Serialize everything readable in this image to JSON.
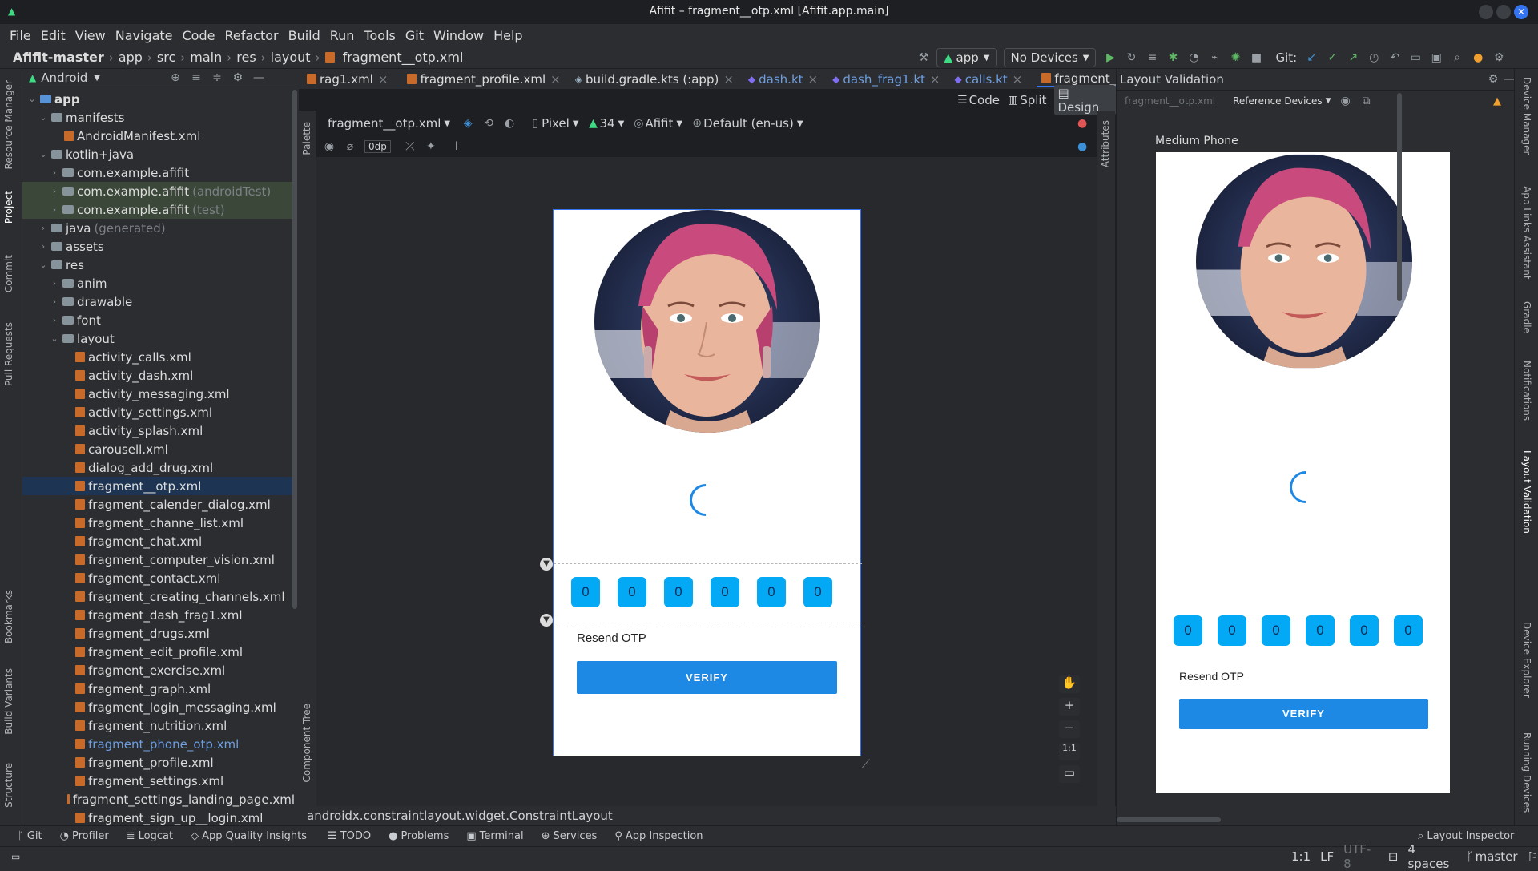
{
  "window": {
    "title": "Afifit – fragment__otp.xml [Afifit.app.main]"
  },
  "menu": [
    "File",
    "Edit",
    "View",
    "Navigate",
    "Code",
    "Refactor",
    "Build",
    "Run",
    "Tools",
    "Git",
    "Window",
    "Help"
  ],
  "breadcrumb": [
    "Afifit-master",
    "app",
    "src",
    "main",
    "res",
    "layout",
    "fragment__otp.xml"
  ],
  "toolbar": {
    "run_config": "app",
    "device": "No Devices",
    "git_label": "Git:"
  },
  "left_strip": [
    "Resource Manager",
    "Project",
    "Commit",
    "Pull Requests",
    "Bookmarks",
    "Build Variants",
    "Structure"
  ],
  "project": {
    "view_label": "Android",
    "tree": [
      {
        "label": "app",
        "depth": 0,
        "kind": "folder",
        "open": true,
        "bold": true
      },
      {
        "label": "manifests",
        "depth": 1,
        "kind": "folder",
        "open": true
      },
      {
        "label": "AndroidManifest.xml",
        "depth": 2,
        "kind": "xml"
      },
      {
        "label": "kotlin+java",
        "depth": 1,
        "kind": "folder",
        "open": true
      },
      {
        "label": "com.example.afifit",
        "depth": 2,
        "kind": "folder",
        "closed": true
      },
      {
        "label": "com.example.afifit",
        "suffix": "(androidTest)",
        "depth": 2,
        "kind": "folder",
        "closed": true,
        "hl": true
      },
      {
        "label": "com.example.afifit",
        "suffix": "(test)",
        "depth": 2,
        "kind": "folder",
        "closed": true,
        "hl": true
      },
      {
        "label": "java",
        "suffix": "(generated)",
        "depth": 1,
        "kind": "folder",
        "closed": true
      },
      {
        "label": "assets",
        "depth": 1,
        "kind": "folder",
        "closed": true
      },
      {
        "label": "res",
        "depth": 1,
        "kind": "folder",
        "open": true
      },
      {
        "label": "anim",
        "depth": 2,
        "kind": "folder",
        "closed": true
      },
      {
        "label": "drawable",
        "depth": 2,
        "kind": "folder",
        "closed": true
      },
      {
        "label": "font",
        "depth": 2,
        "kind": "folder",
        "closed": true
      },
      {
        "label": "layout",
        "depth": 2,
        "kind": "folder",
        "open": true
      },
      {
        "label": "activity_calls.xml",
        "depth": 3,
        "kind": "xml"
      },
      {
        "label": "activity_dash.xml",
        "depth": 3,
        "kind": "xml"
      },
      {
        "label": "activity_messaging.xml",
        "depth": 3,
        "kind": "xml"
      },
      {
        "label": "activity_settings.xml",
        "depth": 3,
        "kind": "xml"
      },
      {
        "label": "activity_splash.xml",
        "depth": 3,
        "kind": "xml"
      },
      {
        "label": "carousell.xml",
        "depth": 3,
        "kind": "xml"
      },
      {
        "label": "dialog_add_drug.xml",
        "depth": 3,
        "kind": "xml"
      },
      {
        "label": "fragment__otp.xml",
        "depth": 3,
        "kind": "xml",
        "sel": true
      },
      {
        "label": "fragment_calender_dialog.xml",
        "depth": 3,
        "kind": "xml"
      },
      {
        "label": "fragment_channe_list.xml",
        "depth": 3,
        "kind": "xml"
      },
      {
        "label": "fragment_chat.xml",
        "depth": 3,
        "kind": "xml"
      },
      {
        "label": "fragment_computer_vision.xml",
        "depth": 3,
        "kind": "xml"
      },
      {
        "label": "fragment_contact.xml",
        "depth": 3,
        "kind": "xml"
      },
      {
        "label": "fragment_creating_channels.xml",
        "depth": 3,
        "kind": "xml"
      },
      {
        "label": "fragment_dash_frag1.xml",
        "depth": 3,
        "kind": "xml"
      },
      {
        "label": "fragment_drugs.xml",
        "depth": 3,
        "kind": "xml"
      },
      {
        "label": "fragment_edit_profile.xml",
        "depth": 3,
        "kind": "xml"
      },
      {
        "label": "fragment_exercise.xml",
        "depth": 3,
        "kind": "xml"
      },
      {
        "label": "fragment_graph.xml",
        "depth": 3,
        "kind": "xml"
      },
      {
        "label": "fragment_login_messaging.xml",
        "depth": 3,
        "kind": "xml"
      },
      {
        "label": "fragment_nutrition.xml",
        "depth": 3,
        "kind": "xml"
      },
      {
        "label": "fragment_phone_otp.xml",
        "depth": 3,
        "kind": "xml",
        "blue": true
      },
      {
        "label": "fragment_profile.xml",
        "depth": 3,
        "kind": "xml"
      },
      {
        "label": "fragment_settings.xml",
        "depth": 3,
        "kind": "xml"
      },
      {
        "label": "fragment_settings_landing_page.xml",
        "depth": 3,
        "kind": "xml"
      },
      {
        "label": "fragment_sign_up__login.xml",
        "depth": 3,
        "kind": "xml"
      }
    ]
  },
  "editor_tabs": [
    {
      "label": "rag1.xml",
      "kind": "xml"
    },
    {
      "label": "fragment_profile.xml",
      "kind": "xml"
    },
    {
      "label": "build.gradle.kts (:app)",
      "kind": "gradle"
    },
    {
      "label": "dash.kt",
      "kind": "kt"
    },
    {
      "label": "dash_frag1.kt",
      "kind": "kt"
    },
    {
      "label": "calls.kt",
      "kind": "kt"
    },
    {
      "label": "fragment__otp.xml",
      "kind": "xml",
      "active": true
    }
  ],
  "view_modes": {
    "code": "Code",
    "split": "Split",
    "design": "Design"
  },
  "design_toolbar": {
    "file": "fragment__otp.xml",
    "device": "Pixel",
    "api": "34",
    "theme": "Afifit",
    "locale": "Default (en-us)",
    "margin": "0dp"
  },
  "side_tabs": {
    "palette": "Palette",
    "component_tree": "Component Tree",
    "attributes": "Attributes"
  },
  "otp_screen": {
    "digits": [
      "0",
      "0",
      "0",
      "0",
      "0",
      "0"
    ],
    "resend": "Resend OTP",
    "verify": "VERIFY"
  },
  "editor_status": "androidx.constraintlayout.widget.ConstraintLayout",
  "validation": {
    "title": "Layout Validation",
    "file": "fragment__otp.xml",
    "reference": "Reference Devices",
    "device_name": "Medium Phone"
  },
  "right_strip": [
    "Device Manager",
    "App Links Assistant",
    "Gradle",
    "Notifications",
    "Layout Validation",
    "Device Explorer",
    "Running Devices"
  ],
  "zoom": {
    "fit": "1:1"
  },
  "bottom_tools": [
    "Git",
    "Profiler",
    "Logcat",
    "App Quality Insights",
    "TODO",
    "Problems",
    "Terminal",
    "Services",
    "App Inspection"
  ],
  "layout_inspector": "Layout Inspector",
  "status": {
    "position": "1:1",
    "line_sep": "LF",
    "encoding": "UTF-8",
    "indent": "4 spaces",
    "branch": "master"
  },
  "colors": {
    "accent": "#3574f0",
    "otp_box": "#03a9f4",
    "verify": "#1e88e5",
    "selection": "#1d3553"
  }
}
